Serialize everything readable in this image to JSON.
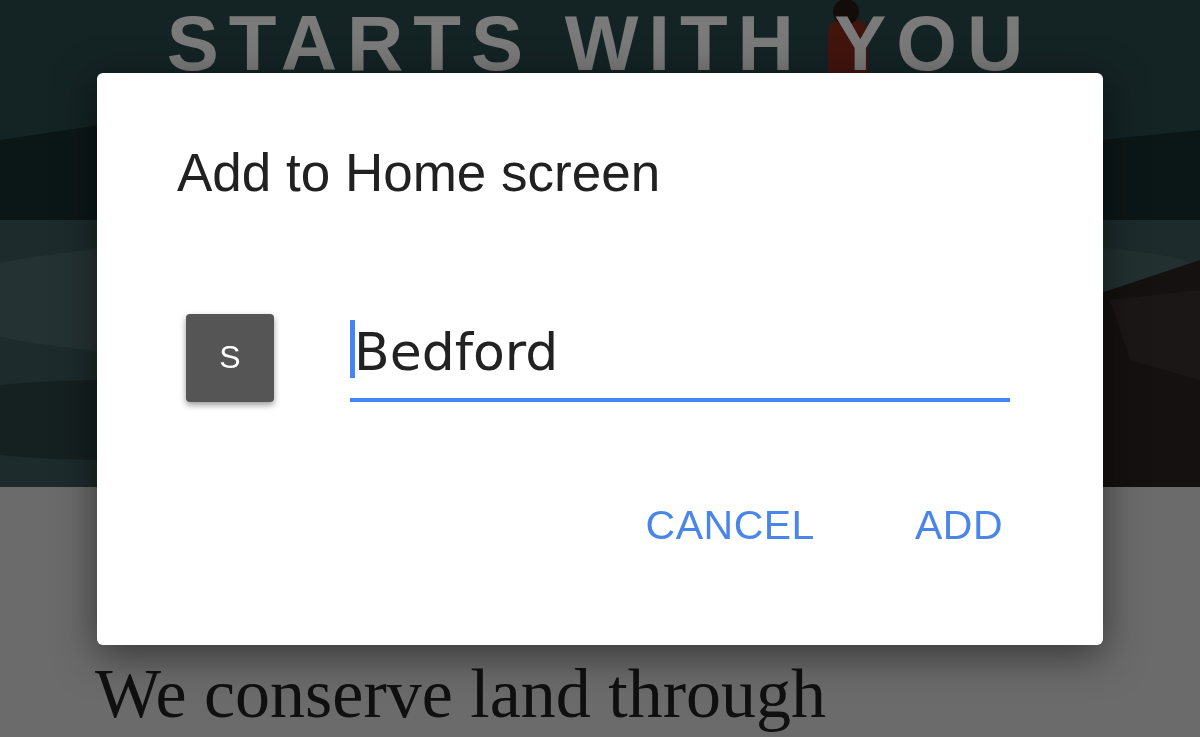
{
  "page": {
    "hero_heading": "STARTS WITH YOU",
    "body_text": "We conserve land through"
  },
  "dialog": {
    "title": "Add to Home screen",
    "app_icon_letter": "S",
    "name_field": {
      "value": "Bedford",
      "focused": true
    },
    "buttons": [
      {
        "label": "CANCEL"
      },
      {
        "label": "ADD"
      }
    ]
  }
}
